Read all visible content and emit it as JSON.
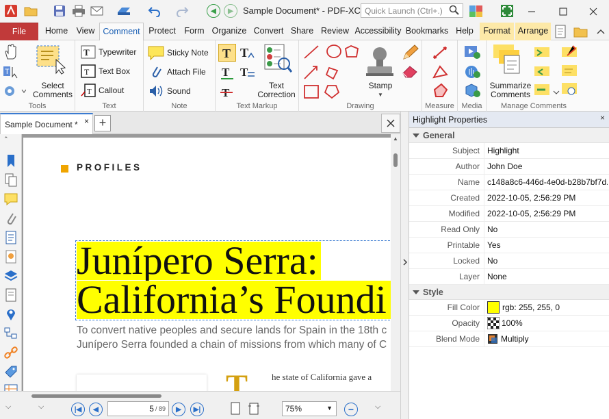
{
  "window": {
    "title": "Sample Document* - PDF-XCh..",
    "quick_launch_placeholder": "Quick Launch (Ctrl+.)"
  },
  "menu": {
    "file": "File",
    "tabs": [
      "Home",
      "View",
      "Comment",
      "Protect",
      "Form",
      "Organize",
      "Convert",
      "Share",
      "Review",
      "Accessibility",
      "Bookmarks",
      "Help"
    ],
    "active": "Comment",
    "contextual": [
      "Format",
      "Arrange"
    ]
  },
  "ribbon": {
    "tools": {
      "label": "Tools",
      "select_comments": "Select\nComments"
    },
    "text": {
      "label": "Text",
      "typewriter": "Typewriter",
      "text_box": "Text Box",
      "callout": "Callout"
    },
    "note": {
      "label": "Note",
      "sticky_note": "Sticky Note",
      "attach_file": "Attach File",
      "sound": "Sound"
    },
    "text_markup": {
      "label": "Text Markup",
      "text_correction": "Text\nCorrection"
    },
    "drawing": {
      "label": "Drawing",
      "stamp": "Stamp"
    },
    "measure": {
      "label": "Measure"
    },
    "media": {
      "label": "Media"
    },
    "manage": {
      "label": "Manage Comments",
      "summarize": "Summarize\nComments"
    }
  },
  "document": {
    "tab_label": "Sample Document *",
    "section": "PROFILES",
    "headline_line1": "Junípero Serra:",
    "headline_line2": "California’s Foundi",
    "body_line1": "To convert native peoples and secure lands for Spain in the 18th c",
    "body_line2": "Junípero Serra founded a chain of missions from which many of C",
    "dropcap": "T",
    "column_text": "he state of California gave a"
  },
  "properties": {
    "title": "Highlight Properties",
    "general": {
      "label": "General",
      "rows": [
        {
          "name": "Subject",
          "value": "Highlight"
        },
        {
          "name": "Author",
          "value": "John Doe"
        },
        {
          "name": "Name",
          "value": "c148a8c6-446d-4e0d-b28b7bf7d.."
        },
        {
          "name": "Created",
          "value": "2022-10-05, 2:56:29 PM"
        },
        {
          "name": "Modified",
          "value": "2022-10-05, 2:56:29 PM"
        },
        {
          "name": "Read Only",
          "value": "No"
        },
        {
          "name": "Printable",
          "value": "Yes"
        },
        {
          "name": "Locked",
          "value": "No"
        },
        {
          "name": "Layer",
          "value": "None"
        }
      ]
    },
    "style": {
      "label": "Style",
      "fill_color_label": "Fill Color",
      "fill_color_value": "rgb: 255, 255, 0",
      "fill_color_hex": "#ffff00",
      "opacity_label": "Opacity",
      "opacity_value": "100%",
      "blend_label": "Blend Mode",
      "blend_value": "Multiply"
    }
  },
  "status": {
    "page_current": "5",
    "page_total": "/ 89",
    "zoom": "75%"
  },
  "colors": {
    "accent": "#1a5fb4",
    "file_tab": "#c13a3a",
    "highlight": "#ffff00",
    "section_marker": "#f0a500"
  }
}
